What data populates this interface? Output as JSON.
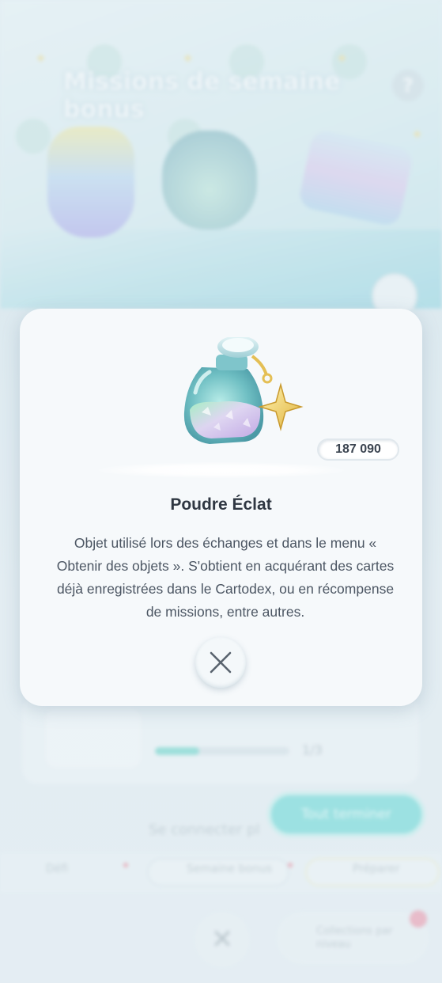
{
  "background": {
    "title": "Missions de semaine bonus",
    "progress_value": 0.33,
    "progress_text": "1/3",
    "complete_all_label": "Tout terminer",
    "connect_text": "Se connecter pl",
    "tabs": [
      "Défi",
      "Semaine bonus",
      "Préparer"
    ],
    "collection_label": "Collections par niveau"
  },
  "modal": {
    "item_name": "Poudre Éclat",
    "item_count": "187 090",
    "description": "Objet utilisé lors des échanges et dans le menu « Obtenir des objets ». S'obtient en acquérant des cartes déjà enregistrées dans le Cartodex, ou en récompense de missions, entre autres.",
    "item_icon": "shinedust-bottle-icon",
    "close_icon": "close-icon"
  },
  "colors": {
    "accent_teal": "#56d6d2",
    "text_dark": "#2f3742",
    "text_body": "#4c5663",
    "badge_pink": "#f08aa0"
  }
}
